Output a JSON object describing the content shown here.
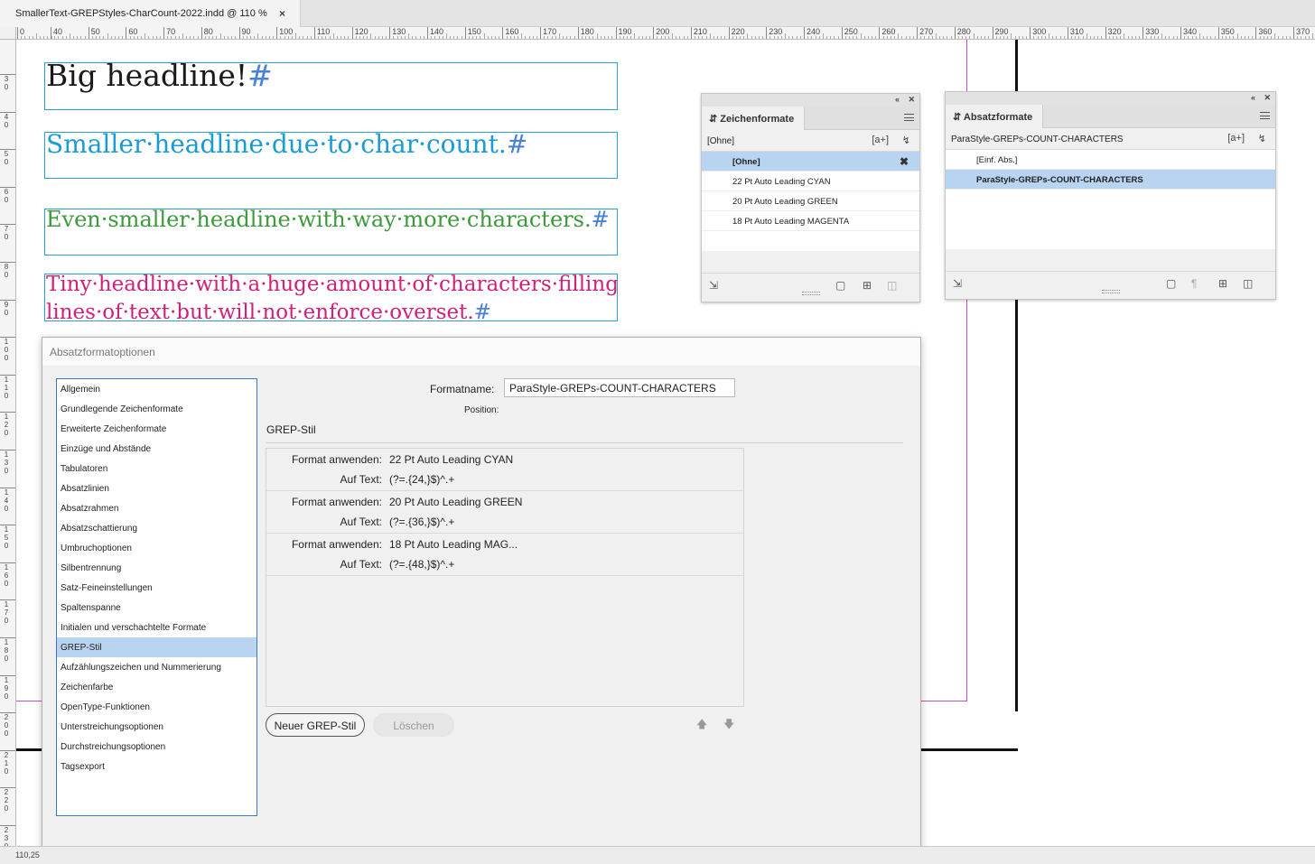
{
  "document": {
    "tab_title": "SmallerText-GREPStyles-CharCount-2022.indd @ 110 %",
    "close_glyph": "×"
  },
  "ruler": {
    "h_labels": [
      "0",
      "40",
      "50",
      "60",
      "70",
      "80",
      "90",
      "100",
      "110",
      "120",
      "130",
      "140",
      "150",
      "160",
      "170",
      "180",
      "190",
      "200",
      "210",
      "220",
      "230",
      "240",
      "250",
      "260",
      "270",
      "280",
      "290",
      "300",
      "310",
      "320",
      "330",
      "340",
      "350",
      "360",
      "370"
    ],
    "v_labels": [
      "3",
      "0",
      "4",
      "0",
      "5",
      "0",
      "6",
      "0",
      "7",
      "0",
      "8",
      "0",
      "9",
      "0",
      "1",
      "0",
      "0",
      "1",
      "1",
      "0",
      "1",
      "2",
      "0",
      "1",
      "3",
      "0",
      "1",
      "4",
      "0",
      "1",
      "5",
      "0",
      "1",
      "6",
      "0",
      "1",
      "7",
      "0",
      "1",
      "8",
      "0",
      "1",
      "9",
      "0",
      "2",
      "0",
      "0",
      "2",
      "1",
      "0",
      "2",
      "2",
      "0",
      "2",
      "3",
      "0"
    ]
  },
  "canvas": {
    "frames": [
      {
        "text": "Big headline!",
        "mark": "#",
        "color": "#1a1a1a"
      },
      {
        "text": "Smaller·headline·due·to·char·count.",
        "mark": "#",
        "color": "#1a9ad6"
      },
      {
        "text": "Even·smaller·headline·with·way·more·characters.",
        "mark": "#",
        "color": "#3c9a3c"
      },
      {
        "line1": "Tiny·headline·with·a·huge·amount·of·characters·filling·two·",
        "line2": "lines·of·text·but·will·not·enforce·overset.",
        "mark": "#",
        "color": "#d0207a"
      }
    ],
    "colors": {
      "margin": "#c050c8",
      "frame": "#2aa0d0"
    }
  },
  "char_panel": {
    "title": "Zeichenformate",
    "current": "[Ohne]",
    "items": [
      "[Ohne]",
      "22 Pt Auto Leading CYAN",
      "20 Pt Auto Leading GREEN",
      "18 Pt Auto Leading MAGENTA"
    ],
    "selected_index": 0
  },
  "para_panel": {
    "title": "Absatzformate",
    "current": "ParaStyle-GREPs-COUNT-CHARACTERS",
    "items": [
      "[Einf. Abs.]",
      "ParaStyle-GREPs-COUNT-CHARACTERS"
    ],
    "selected_index": 1
  },
  "dialog": {
    "title": "Absatzformatoptionen",
    "nav": [
      "Allgemein",
      "Grundlegende Zeichenformate",
      "Erweiterte Zeichenformate",
      "Einzüge und Abstände",
      "Tabulatoren",
      "Absatzlinien",
      "Absatzrahmen",
      "Absatzschattierung",
      "Umbruchoptionen",
      "Silbentrennung",
      "Satz-Feineinstellungen",
      "Spaltenspanne",
      "Initialen und verschachtelte Formate",
      "GREP-Stil",
      "Aufzählungszeichen und Nummerierung",
      "Zeichenfarbe",
      "OpenType-Funktionen",
      "Unterstreichungsoptionen",
      "Durchstreichungsoptionen",
      "Tagsexport"
    ],
    "nav_selected": "GREP-Stil",
    "formatname_label": "Formatname:",
    "formatname_value": "ParaStyle-GREPs-COUNT-CHARACTERS",
    "position_label": "Position:",
    "section_title": "GREP-Stil",
    "rules": [
      {
        "apply_label": "Format anwenden:",
        "apply": "22 Pt Auto Leading CYAN",
        "text_label": "Auf Text:",
        "text": "(?=.{24,}$)^.+"
      },
      {
        "apply_label": "Format anwenden:",
        "apply": "20 Pt Auto Leading GREEN",
        "text_label": "Auf Text:",
        "text": "(?=.{36,}$)^.+"
      },
      {
        "apply_label": "Format anwenden:",
        "apply": "18 Pt Auto Leading MAG...",
        "text_label": "Auf Text:",
        "text": "(?=.{48,}$)^.+"
      }
    ],
    "new_button": "Neuer GREP-Stil",
    "delete_button": "Löschen"
  },
  "status": {
    "coords": "110,25"
  }
}
